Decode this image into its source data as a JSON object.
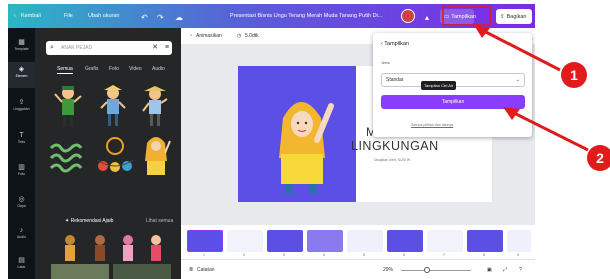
{
  "topbar": {
    "back": "Kembali",
    "file": "File",
    "resize": "Ubah ukuran",
    "title": "Presentasi Bisnis Ungu Terang Merah Muda Tanang Putih Di...",
    "share_label": "Tampilkan",
    "publish_label": "Bagikan"
  },
  "rail": [
    {
      "icon": "▦",
      "label": "Template"
    },
    {
      "icon": "◈",
      "label": "Elemen"
    },
    {
      "icon": "⇪",
      "label": "Unggahan"
    },
    {
      "icon": "T",
      "label": "Teks"
    },
    {
      "icon": "▥",
      "label": "Foto"
    },
    {
      "icon": "◎",
      "label": "Gaya"
    },
    {
      "icon": "♪",
      "label": "Audio"
    },
    {
      "icon": "▤",
      "label": "Latar"
    }
  ],
  "panel": {
    "search_value": "ANAK PEJAD",
    "tabs": [
      "Semua",
      "Grafis",
      "Foto",
      "Video",
      "Audio"
    ],
    "rec_title": "Rekomendasi Ajaib",
    "rec_link": "Lihat semua"
  },
  "canvas": {
    "animate_label": "Animasikan",
    "duration_label": "5.0dtk",
    "slide_title_1": "M",
    "slide_title_2": "LINGKUNGAN",
    "slide_sub": "Disajikan oleh: SUSI W"
  },
  "thumbnails": [
    "1",
    "2",
    "3",
    "4",
    "5",
    "6",
    "7",
    "8",
    "9"
  ],
  "status": {
    "notes_label": "Catatan",
    "zoom": "29%"
  },
  "dropdown": {
    "title": "Tampilkan",
    "label": "Jenis",
    "select_value": "Standar",
    "tooltip": "Tampilan  Ctrl  Alt",
    "primary_button": "Tampilkan",
    "link": "Semua pilihan dan lainnya"
  },
  "annotations": {
    "one": "1",
    "two": "2",
    "color": "#e11b1b"
  }
}
